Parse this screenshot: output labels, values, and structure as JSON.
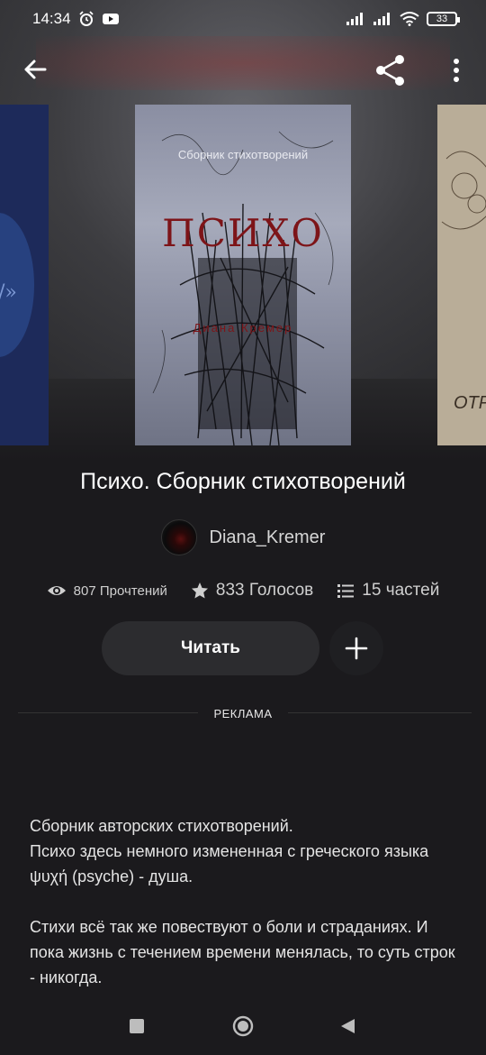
{
  "status_bar": {
    "time": "14:34",
    "battery": "33",
    "icons": [
      "alarm-icon",
      "youtube-icon",
      "signal-icon",
      "signal-icon",
      "wifi-icon",
      "battery-icon"
    ]
  },
  "toolbar": {
    "back_icon": "arrow-left-icon",
    "share_icon": "share-icon",
    "more_icon": "more-vertical-icon"
  },
  "cover": {
    "subtitle": "Сборник стихотворений",
    "title": "ПСИХО",
    "author": "Диана Кремер",
    "right_partial": "ОТР",
    "left_partial": "/»"
  },
  "book": {
    "title": "Психо. Сборник стихотворений",
    "author": "Diana_Kremer"
  },
  "stats": {
    "reads": "807 Прочтений",
    "votes": "833 Голосов",
    "parts": "15 частей"
  },
  "actions": {
    "read_label": "Читать",
    "add_icon": "plus-icon"
  },
  "ad": {
    "label": "РЕКЛАМА"
  },
  "description": {
    "line1": "Сборник авторских стихотворений.",
    "line2": "Психо здесь немного измененная с греческого языка ψυχή (psyche) - душа.",
    "line3": "Стихи всё так же повествуют о боли и страданиях. И пока жизнь с течением времени менялась, то суть строк - никогда."
  },
  "colors": {
    "background": "#1b1a1d",
    "button": "#2c2c2f",
    "cover_title": "#7d1418"
  }
}
